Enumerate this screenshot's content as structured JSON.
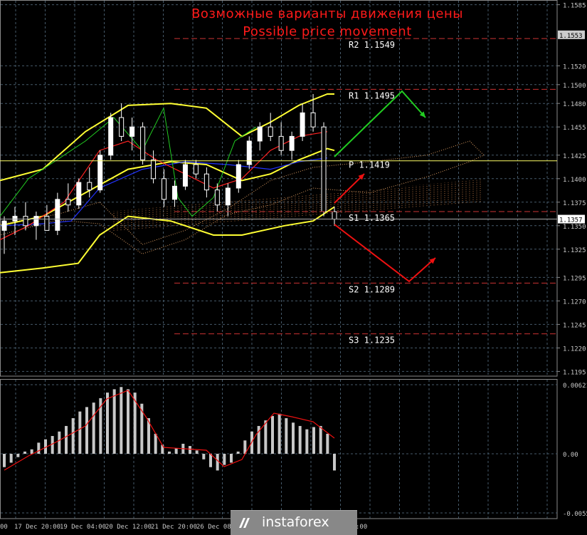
{
  "title_ru": "Возможные варианты движения цены",
  "title_en": "Possible price movement",
  "colors": {
    "background": "#000000",
    "grid": "#465a6a",
    "bull_candle": "#ffffff",
    "bear_candle": "#ffffff",
    "bollinger": "#ffff33",
    "tenkan": "#ff2222",
    "kijun": "#2233ff",
    "chikou": "#22cc22",
    "level_line": "#cc3333",
    "pivot_line": "#ffff66",
    "arrow_up": "#22cc22",
    "arrow_down": "#ee1111",
    "macd_hist": "#c8c8c8",
    "macd_signal": "#ee1111"
  },
  "price_axis": {
    "ticks": [
      "1.1585",
      "1.1520",
      "1.1475",
      "1.1450",
      "1.1425",
      "1.1400",
      "1.1375",
      "1.1350",
      "1.1325",
      "1.1295",
      "1.1270",
      "1.1245",
      "1.1220",
      "1.1195"
    ],
    "tick_values": [
      1.1585,
      1.152,
      1.15,
      1.148,
      1.1455,
      1.1425,
      1.14,
      1.1375,
      1.135,
      1.1325,
      1.1295,
      1.127,
      1.1245,
      1.122,
      1.1195
    ],
    "tick_labels": [
      "1.1585",
      "1.1520",
      "1.1500",
      "1.1480",
      "1.1455",
      "1.1425",
      "1.1400",
      "1.1375",
      "1.1350",
      "1.1325",
      "1.1295",
      "1.1270",
      "1.1245",
      "1.1220",
      "1.1195"
    ],
    "current_price_label": "1.1357",
    "r2_tag": "1.1553"
  },
  "macd_axis": {
    "tick_labels": [
      "0.00621",
      "0.00",
      "-0.00554"
    ]
  },
  "time_axis": {
    "labels": [
      "00",
      "17 Dec 20:00",
      "19 Dec 04:00",
      "20 Dec 12:00",
      "21 Dec 20:00",
      "26 Dec 08:00",
      ":00"
    ]
  },
  "levels": [
    {
      "name": "R2",
      "value": "1.1549",
      "label": "R2  1.1549"
    },
    {
      "name": "R1",
      "value": "1.1495",
      "label": "R1  1.1495"
    },
    {
      "name": "P",
      "value": "1.1419",
      "label": "P  1.1419"
    },
    {
      "name": "S1",
      "value": "1.1365",
      "label": "S1  1.1365"
    },
    {
      "name": "S2",
      "value": "1.1289",
      "label": "S2  1.1289"
    },
    {
      "name": "S3",
      "value": "1.1235",
      "label": "S3  1.1235"
    }
  ],
  "logo_text": "instaforex",
  "chart_data": {
    "type": "candlestick",
    "instrument_note": "",
    "ylim": [
      1.119,
      1.159
    ],
    "levels": {
      "R2": 1.1549,
      "R1": 1.1495,
      "P": 1.1419,
      "S1": 1.1365,
      "S2": 1.1289,
      "S3": 1.1235
    },
    "current_price": 1.1357,
    "candles_ohlc_approx": [
      [
        1.1345,
        1.136,
        1.132,
        1.1355
      ],
      [
        1.1355,
        1.137,
        1.134,
        1.136
      ],
      [
        1.136,
        1.1375,
        1.1345,
        1.135
      ],
      [
        1.135,
        1.1365,
        1.1335,
        1.136
      ],
      [
        1.136,
        1.1372,
        1.1348,
        1.1345
      ],
      [
        1.1345,
        1.1385,
        1.134,
        1.1378
      ],
      [
        1.1378,
        1.1395,
        1.1365,
        1.1372
      ],
      [
        1.1372,
        1.14,
        1.1368,
        1.1396
      ],
      [
        1.1396,
        1.1412,
        1.138,
        1.1388
      ],
      [
        1.1388,
        1.143,
        1.1385,
        1.1425
      ],
      [
        1.1425,
        1.147,
        1.142,
        1.1465
      ],
      [
        1.1465,
        1.148,
        1.144,
        1.1445
      ],
      [
        1.1445,
        1.1465,
        1.143,
        1.1455
      ],
      [
        1.1455,
        1.146,
        1.1415,
        1.142
      ],
      [
        1.142,
        1.143,
        1.1395,
        1.14
      ],
      [
        1.14,
        1.141,
        1.137,
        1.1378
      ],
      [
        1.1378,
        1.1398,
        1.137,
        1.1392
      ],
      [
        1.1392,
        1.142,
        1.1388,
        1.1415
      ],
      [
        1.1415,
        1.142,
        1.14,
        1.1405
      ],
      [
        1.1405,
        1.1412,
        1.138,
        1.1388
      ],
      [
        1.1388,
        1.1395,
        1.1365,
        1.1372
      ],
      [
        1.1372,
        1.1395,
        1.136,
        1.139
      ],
      [
        1.139,
        1.142,
        1.1385,
        1.1415
      ],
      [
        1.1415,
        1.1445,
        1.141,
        1.144
      ],
      [
        1.144,
        1.146,
        1.143,
        1.1455
      ],
      [
        1.1455,
        1.147,
        1.144,
        1.1445
      ],
      [
        1.1445,
        1.146,
        1.1425,
        1.143
      ],
      [
        1.143,
        1.145,
        1.142,
        1.1445
      ],
      [
        1.1445,
        1.148,
        1.144,
        1.147
      ],
      [
        1.147,
        1.149,
        1.145,
        1.1455
      ],
      [
        1.1455,
        1.146,
        1.136,
        1.1365
      ],
      [
        1.1365,
        1.137,
        1.135,
        1.1357
      ]
    ],
    "indicators": [
      "Bollinger Bands",
      "Ichimoku",
      "MACD"
    ],
    "macd": {
      "ylim": [
        -0.00554,
        0.00621
      ]
    }
  }
}
